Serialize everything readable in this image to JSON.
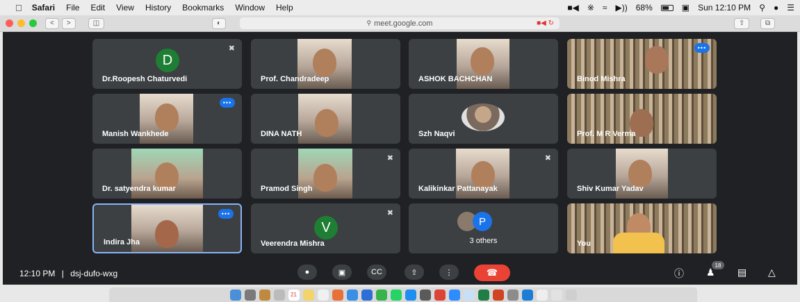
{
  "menubar": {
    "app": "Safari",
    "items": [
      "File",
      "Edit",
      "View",
      "History",
      "Bookmarks",
      "Window",
      "Help"
    ],
    "battery": "68%",
    "clock": "Sun 12:10 PM"
  },
  "browser": {
    "url": "meet.google.com"
  },
  "tiles": [
    {
      "name": "Dr.Roopesh Chaturvedi",
      "initial": "D",
      "avatar_color": "#1e7e34"
    },
    {
      "name": "Prof. Chandradeep"
    },
    {
      "name": "ASHOK BACHCHAN"
    },
    {
      "name": "Binod Mishra"
    },
    {
      "name": "Manish Wankhede"
    },
    {
      "name": "DINA NATH"
    },
    {
      "name": "Szh Naqvi"
    },
    {
      "name": "Prof. M R Verma"
    },
    {
      "name": "Dr. satyendra kumar"
    },
    {
      "name": "Pramod Singh"
    },
    {
      "name": "Kalikinkar Pattanayak"
    },
    {
      "name": "Shiv Kumar Yadav"
    },
    {
      "name": "Indira Jha"
    },
    {
      "name": "Veerendra Mishra",
      "initial": "V",
      "avatar_color": "#1e7e34"
    },
    {
      "name": "3 others",
      "initial": "P",
      "avatar_color": "#1a73e8"
    },
    {
      "name": "You"
    }
  ],
  "meeting": {
    "time": "12:10 PM",
    "separator": "|",
    "code": "dsj-dufo-wxg",
    "participants_count": "18"
  },
  "icons": {
    "mic": "microphone-icon",
    "camera": "camera-icon",
    "captions": "captions-icon",
    "present": "present-icon",
    "more": "more-icon",
    "end": "end-call-icon",
    "info": "info-icon",
    "people": "people-icon",
    "chat": "chat-icon",
    "activities": "activities-icon"
  },
  "colors": {
    "meet_bg": "#202124",
    "tile_bg": "#3c4043",
    "accent_blue": "#1a73e8",
    "end_red": "#ea4335"
  }
}
